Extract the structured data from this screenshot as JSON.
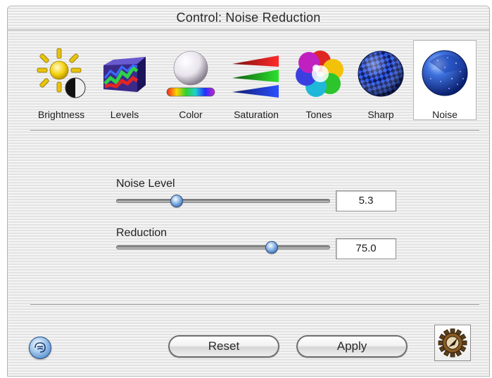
{
  "window": {
    "title": "Control: Noise Reduction"
  },
  "toolbar": {
    "items": [
      {
        "label": "Brightness",
        "icon": "brightness-icon"
      },
      {
        "label": "Levels",
        "icon": "levels-icon"
      },
      {
        "label": "Color",
        "icon": "color-icon"
      },
      {
        "label": "Saturation",
        "icon": "saturation-icon"
      },
      {
        "label": "Tones",
        "icon": "tones-icon"
      },
      {
        "label": "Sharp",
        "icon": "sharp-icon"
      },
      {
        "label": "Noise",
        "icon": "noise-icon",
        "selected": true
      }
    ]
  },
  "controls": {
    "noise_level": {
      "label": "Noise Level",
      "value": "5.3",
      "fraction": 0.28
    },
    "reduction": {
      "label": "Reduction",
      "value": "75.0",
      "fraction": 0.73
    }
  },
  "buttons": {
    "reset_label": "Reset",
    "apply_label": "Apply",
    "help_icon": "help-icon",
    "gear_icon": "gear-icon"
  },
  "colors": {
    "accent_blue": "#5d8fd0",
    "window_background": "#ececec"
  }
}
